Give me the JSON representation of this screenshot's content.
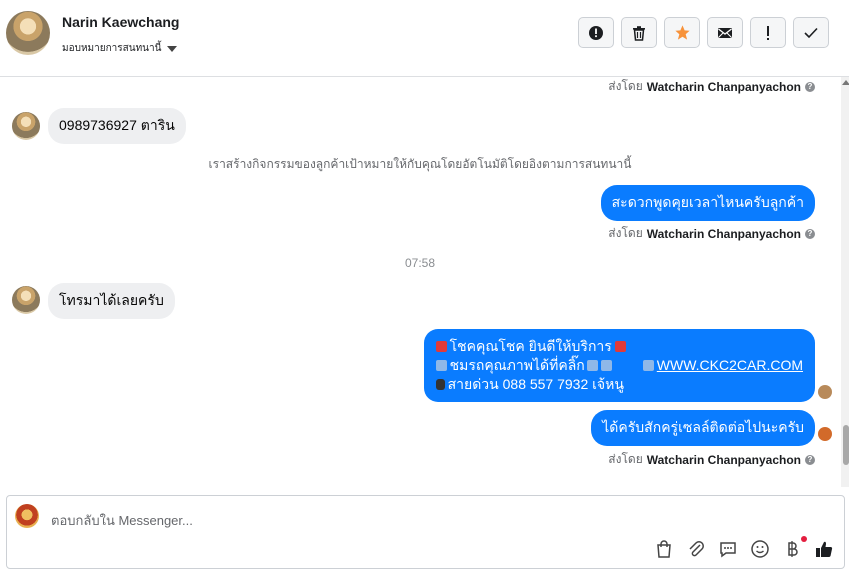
{
  "header": {
    "name": "Narin Kaewchang",
    "assign_label": "มอบหมายการสนทนานี้",
    "actions": [
      {
        "name": "spam-button",
        "icon": "alert-circle-icon"
      },
      {
        "name": "delete-button",
        "icon": "trash-icon"
      },
      {
        "name": "star-button",
        "icon": "star-icon"
      },
      {
        "name": "mark-unread-button",
        "icon": "envelope-icon"
      },
      {
        "name": "follow-up-button",
        "icon": "exclamation-icon"
      },
      {
        "name": "mark-done-button",
        "icon": "check-icon"
      }
    ],
    "star_color": "#f7923a"
  },
  "messages": {
    "sent_by_prefix": "ส่งโดย",
    "sender": "Watcharin Chanpanyachon",
    "help": "?",
    "in1": "0989736927  ตาริน",
    "system": "เราสร้างกิจกรรมของลูกค้าเป้าหมายให้กับคุณโดยอัตโนมัติโดยอิงตามการสนทนานี้",
    "out1": "สะดวกพูดคุยเวลาไหนครับลูกค้า",
    "time": "07:58",
    "in2": "โทรมาได้เลยครับ",
    "out2_line1": "โชคคุณโชค ยินดีให้บริการ",
    "out2_line2": "ชมรถคุณภาพได้ที่คลิ๊ก",
    "out2_link": "WWW.CKC2CAR.COM",
    "out2_line3": "สายด่วน 088 557 7932 เจ้หนู",
    "out3": "ได้ครับสักครู่เซลล์ติดต่อไปนะครับ",
    "bubble_color": "#0a7cff"
  },
  "composer": {
    "placeholder": "ตอบกลับใน Messenger...",
    "tools": [
      "shopping-bag-icon",
      "paperclip-icon",
      "saved-replies-icon",
      "emoji-icon",
      "baht-icon",
      "like-icon"
    ]
  }
}
